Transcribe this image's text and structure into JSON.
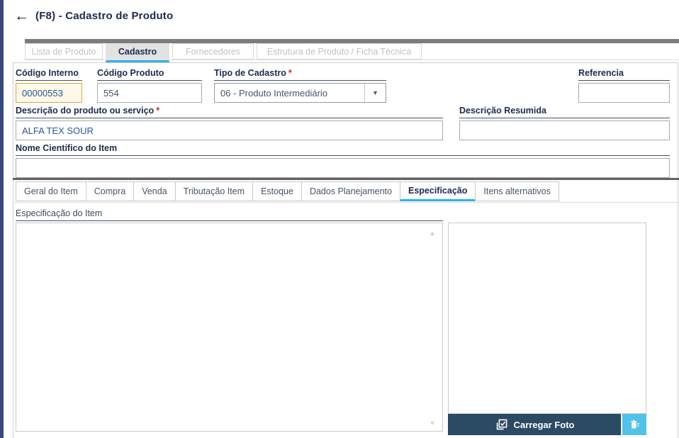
{
  "header": {
    "back_arrow": "←",
    "title": "(F8) - Cadastro de Produto"
  },
  "main_tabs": [
    {
      "label": "Lista de Produto",
      "active": false
    },
    {
      "label": "Cadastro",
      "active": true
    },
    {
      "label": "Fornecedores",
      "active": false
    },
    {
      "label": "Estrutura de Produto / Ficha Técnica",
      "active": false
    }
  ],
  "form": {
    "codigo_interno": {
      "label": "Código Interno",
      "value": "00000553"
    },
    "codigo_produto": {
      "label": "Código Produto",
      "value": "554"
    },
    "tipo_cadastro": {
      "label": "Tipo de Cadastro",
      "required_mark": "*",
      "value": "06 - Produto Intermediário"
    },
    "referencia": {
      "label": "Referencia",
      "value": ""
    },
    "descricao_produto": {
      "label": "Descrição do produto ou serviço",
      "required_mark": "*",
      "value": "ALFA TEX SOUR"
    },
    "descricao_resumida": {
      "label": "Descrição Resumida",
      "value": ""
    },
    "nome_cientifico": {
      "label": "Nome Científico do Item",
      "value": ""
    }
  },
  "sub_tabs": [
    {
      "label": "Geral do Item",
      "active": false
    },
    {
      "label": "Compra",
      "active": false
    },
    {
      "label": "Venda",
      "active": false
    },
    {
      "label": "Tributação Item",
      "active": false
    },
    {
      "label": "Estoque",
      "active": false
    },
    {
      "label": "Dados Planejamento",
      "active": false
    },
    {
      "label": "Especificação",
      "active": true
    },
    {
      "label": "Itens alternativos",
      "active": false
    }
  ],
  "especificacao": {
    "label": "Especificação do Item",
    "value": ""
  },
  "scrollbar": {
    "up_glyph": "▲",
    "down_glyph": "▼"
  },
  "dropdown": {
    "arrow_glyph": "▼"
  },
  "photo": {
    "carregar_foto_label": "Carregar Foto"
  },
  "colors": {
    "accent_cyan": "#2ab2e7",
    "left_strip": "#35497c",
    "button_dark": "#2b4a63",
    "button_light": "#53c2ea",
    "locked_border": "#e0a43e",
    "value_blue": "#2b579a",
    "required_red": "#e01b1b"
  }
}
